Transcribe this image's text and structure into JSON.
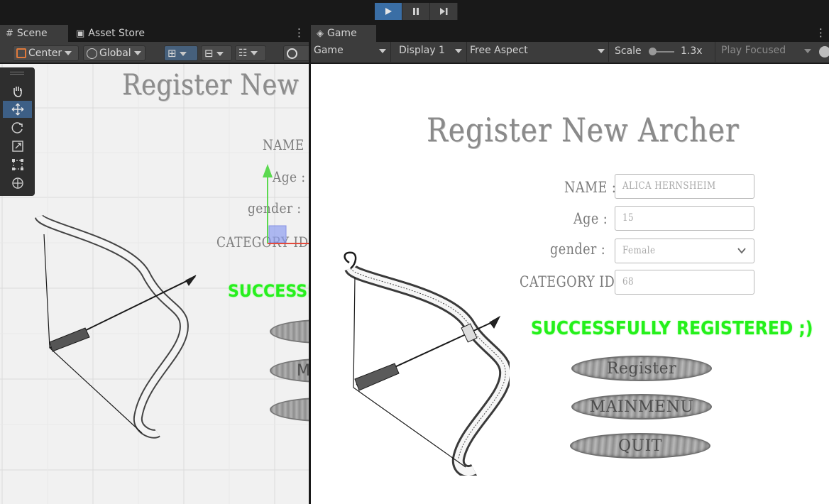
{
  "playbar": {
    "play": "play-icon",
    "pause": "pause-icon",
    "step": "step-icon"
  },
  "scene_panel": {
    "tabs": [
      {
        "label": "Scene",
        "icon": "grid-icon",
        "active": true
      },
      {
        "label": "Asset Store",
        "icon": "bag-icon",
        "active": false
      }
    ],
    "toolbar": {
      "pivot": "Center",
      "space": "Global"
    },
    "tools": [
      "hand-tool",
      "move-tool",
      "rotate-tool",
      "scale-tool",
      "rect-tool",
      "transform-tool"
    ]
  },
  "game_panel": {
    "tab": {
      "label": "Game",
      "icon": "gamepad-icon"
    },
    "toolbar": {
      "mode": "Game",
      "display": "Display 1",
      "aspect": "Free Aspect",
      "scale_label": "Scale",
      "scale_value": "1.3x",
      "play_focused": "Play Focused"
    }
  },
  "form": {
    "title": "Register New Archer",
    "scene_title": "Register New",
    "labels": {
      "name": "NAME :",
      "age": "Age :",
      "gender": "gender :",
      "category": "CATEGORY ID :"
    },
    "values": {
      "name": "ALICA HERNSHEIM",
      "age": "15",
      "gender": "Female",
      "category": "68"
    },
    "success": "SUCCESSFULLY REGISTERED ;)",
    "scene_success": "SUCCESSF",
    "buttons": {
      "register": "Register",
      "mainmenu": "MAINMENU",
      "quit": "QUIT"
    },
    "scene_button_fragment": "M"
  },
  "colors": {
    "success_green": "#24f01a",
    "accent_blue": "#3a6ea5",
    "editor_bg": "#3c3c3c"
  }
}
